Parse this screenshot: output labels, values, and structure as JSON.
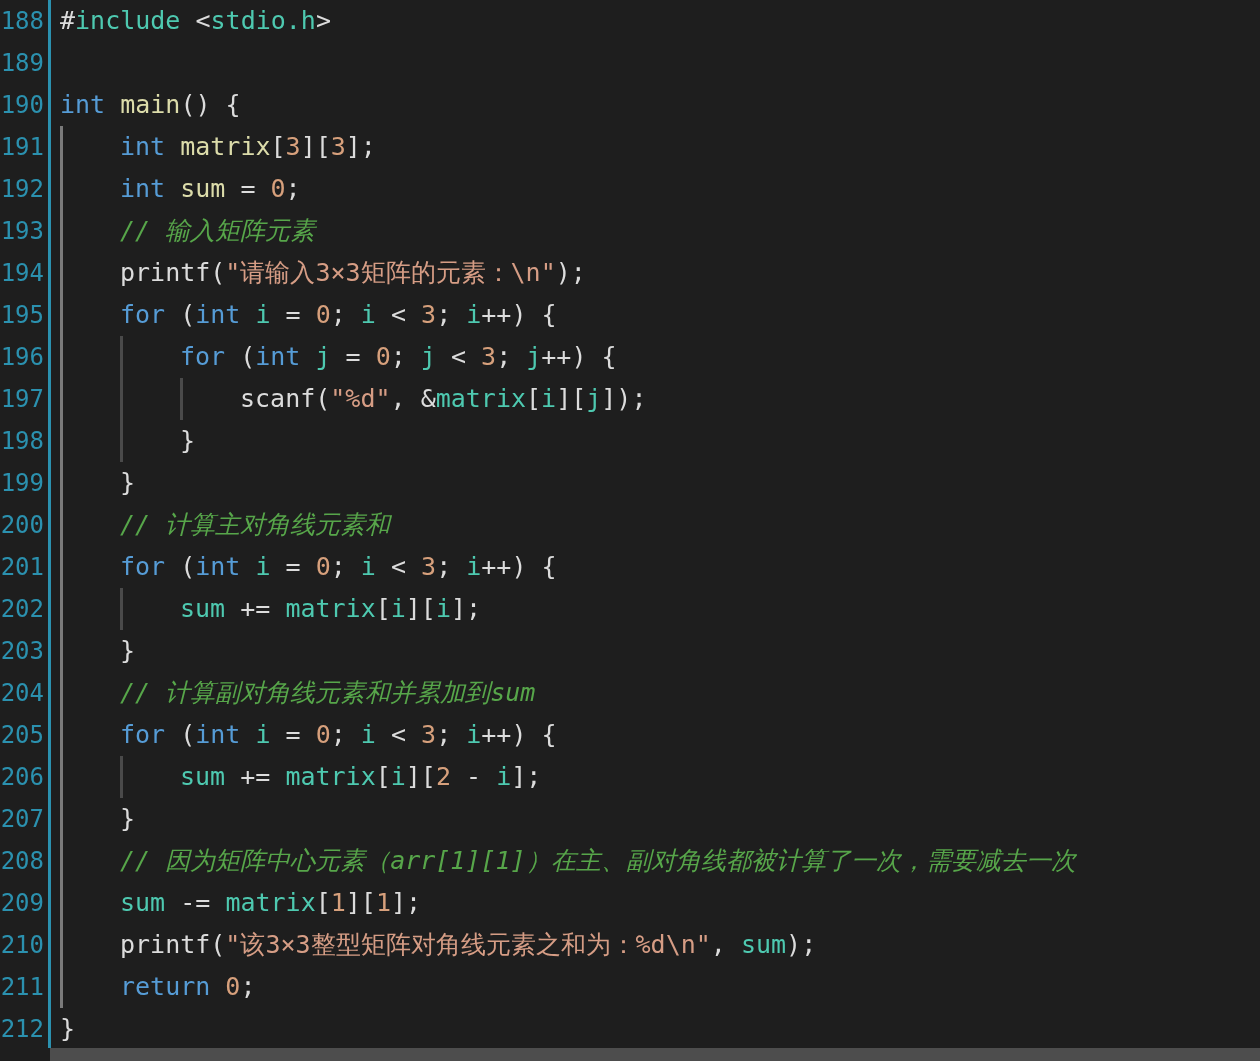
{
  "editor": {
    "lines": [
      {
        "number": "188",
        "tokens": [
          {
            "kind": "pun",
            "text": "#"
          },
          {
            "kind": "var",
            "text": "include"
          },
          {
            "kind": "pun",
            "text": " <"
          },
          {
            "kind": "var",
            "text": "stdio.h"
          },
          {
            "kind": "pun",
            "text": ">"
          }
        ]
      },
      {
        "number": "189"
      },
      {
        "number": "190",
        "tokens": [
          {
            "kind": "kw",
            "text": "int"
          },
          {
            "kind": "fn",
            "text": " main"
          },
          {
            "kind": "pun",
            "text": "() {"
          }
        ],
        "children": [
          {
            "number": "191",
            "tokens": [
              {
                "kind": "kw",
                "text": "int"
              },
              {
                "kind": "fn",
                "text": " matrix"
              },
              {
                "kind": "pun",
                "text": "["
              },
              {
                "kind": "num",
                "text": "3"
              },
              {
                "kind": "pun",
                "text": "]["
              },
              {
                "kind": "num",
                "text": "3"
              },
              {
                "kind": "pun",
                "text": "];"
              }
            ]
          },
          {
            "number": "192",
            "tokens": [
              {
                "kind": "kw",
                "text": "int"
              },
              {
                "kind": "fn",
                "text": " sum"
              },
              {
                "kind": "pun",
                "text": " = "
              },
              {
                "kind": "num",
                "text": "0"
              },
              {
                "kind": "pun",
                "text": ";"
              }
            ]
          },
          {
            "number": "193",
            "tokens": [
              {
                "kind": "com",
                "text": "// 输入矩阵元素"
              }
            ]
          },
          {
            "number": "194",
            "tokens": [
              {
                "kind": "pun",
                "text": "printf("
              },
              {
                "kind": "str",
                "text": "\"请输入3×3矩阵的元素：\\n\""
              },
              {
                "kind": "pun",
                "text": ");"
              }
            ]
          },
          {
            "number": "195",
            "tokens": [
              {
                "kind": "kw",
                "text": "for"
              },
              {
                "kind": "pun",
                "text": " ("
              },
              {
                "kind": "kw",
                "text": "int"
              },
              {
                "kind": "var",
                "text": " i"
              },
              {
                "kind": "pun",
                "text": " = "
              },
              {
                "kind": "num",
                "text": "0"
              },
              {
                "kind": "pun",
                "text": "; "
              },
              {
                "kind": "var",
                "text": "i"
              },
              {
                "kind": "pun",
                "text": " < "
              },
              {
                "kind": "num",
                "text": "3"
              },
              {
                "kind": "pun",
                "text": "; "
              },
              {
                "kind": "var",
                "text": "i"
              },
              {
                "kind": "pun",
                "text": "++) {"
              }
            ],
            "children": [
              {
                "number": "196",
                "tokens": [
                  {
                    "kind": "kw",
                    "text": "for"
                  },
                  {
                    "kind": "pun",
                    "text": " ("
                  },
                  {
                    "kind": "kw",
                    "text": "int"
                  },
                  {
                    "kind": "var",
                    "text": " j"
                  },
                  {
                    "kind": "pun",
                    "text": " = "
                  },
                  {
                    "kind": "num",
                    "text": "0"
                  },
                  {
                    "kind": "pun",
                    "text": "; "
                  },
                  {
                    "kind": "var",
                    "text": "j"
                  },
                  {
                    "kind": "pun",
                    "text": " < "
                  },
                  {
                    "kind": "num",
                    "text": "3"
                  },
                  {
                    "kind": "pun",
                    "text": "; "
                  },
                  {
                    "kind": "var",
                    "text": "j"
                  },
                  {
                    "kind": "pun",
                    "text": "++) {"
                  }
                ],
                "children": [
                  {
                    "number": "197",
                    "tokens": [
                      {
                        "kind": "pun",
                        "text": "scanf("
                      },
                      {
                        "kind": "str",
                        "text": "\"%d\""
                      },
                      {
                        "kind": "pun",
                        "text": ", &"
                      },
                      {
                        "kind": "var",
                        "text": "matrix"
                      },
                      {
                        "kind": "pun",
                        "text": "["
                      },
                      {
                        "kind": "var",
                        "text": "i"
                      },
                      {
                        "kind": "pun",
                        "text": "]["
                      },
                      {
                        "kind": "var",
                        "text": "j"
                      },
                      {
                        "kind": "pun",
                        "text": "]);"
                      }
                    ]
                  }
                ]
              },
              {
                "number": "198",
                "tokens": [
                  {
                    "kind": "pun",
                    "text": "}"
                  }
                ]
              }
            ]
          },
          {
            "number": "199",
            "tokens": [
              {
                "kind": "pun",
                "text": "}"
              }
            ]
          },
          {
            "number": "200",
            "tokens": [
              {
                "kind": "com",
                "text": "// 计算主对角线元素和"
              }
            ]
          },
          {
            "number": "201",
            "tokens": [
              {
                "kind": "kw",
                "text": "for"
              },
              {
                "kind": "pun",
                "text": " ("
              },
              {
                "kind": "kw",
                "text": "int"
              },
              {
                "kind": "var",
                "text": " i"
              },
              {
                "kind": "pun",
                "text": " = "
              },
              {
                "kind": "num",
                "text": "0"
              },
              {
                "kind": "pun",
                "text": "; "
              },
              {
                "kind": "var",
                "text": "i"
              },
              {
                "kind": "pun",
                "text": " < "
              },
              {
                "kind": "num",
                "text": "3"
              },
              {
                "kind": "pun",
                "text": "; "
              },
              {
                "kind": "var",
                "text": "i"
              },
              {
                "kind": "pun",
                "text": "++) {"
              }
            ],
            "children": [
              {
                "number": "202",
                "tokens": [
                  {
                    "kind": "var",
                    "text": "sum"
                  },
                  {
                    "kind": "pun",
                    "text": " += "
                  },
                  {
                    "kind": "var",
                    "text": "matrix"
                  },
                  {
                    "kind": "pun",
                    "text": "["
                  },
                  {
                    "kind": "var",
                    "text": "i"
                  },
                  {
                    "kind": "pun",
                    "text": "]["
                  },
                  {
                    "kind": "var",
                    "text": "i"
                  },
                  {
                    "kind": "pun",
                    "text": "];"
                  }
                ]
              }
            ]
          },
          {
            "number": "203",
            "tokens": [
              {
                "kind": "pun",
                "text": "}"
              }
            ]
          },
          {
            "number": "204",
            "tokens": [
              {
                "kind": "com",
                "text": "// 计算副对角线元素和并累加到sum"
              }
            ]
          },
          {
            "number": "205",
            "tokens": [
              {
                "kind": "kw",
                "text": "for"
              },
              {
                "kind": "pun",
                "text": " ("
              },
              {
                "kind": "kw",
                "text": "int"
              },
              {
                "kind": "var",
                "text": " i"
              },
              {
                "kind": "pun",
                "text": " = "
              },
              {
                "kind": "num",
                "text": "0"
              },
              {
                "kind": "pun",
                "text": "; "
              },
              {
                "kind": "var",
                "text": "i"
              },
              {
                "kind": "pun",
                "text": " < "
              },
              {
                "kind": "num",
                "text": "3"
              },
              {
                "kind": "pun",
                "text": "; "
              },
              {
                "kind": "var",
                "text": "i"
              },
              {
                "kind": "pun",
                "text": "++) {"
              }
            ],
            "children": [
              {
                "number": "206",
                "tokens": [
                  {
                    "kind": "var",
                    "text": "sum"
                  },
                  {
                    "kind": "pun",
                    "text": " += "
                  },
                  {
                    "kind": "var",
                    "text": "matrix"
                  },
                  {
                    "kind": "pun",
                    "text": "["
                  },
                  {
                    "kind": "var",
                    "text": "i"
                  },
                  {
                    "kind": "pun",
                    "text": "]["
                  },
                  {
                    "kind": "num",
                    "text": "2"
                  },
                  {
                    "kind": "pun",
                    "text": " - "
                  },
                  {
                    "kind": "var",
                    "text": "i"
                  },
                  {
                    "kind": "pun",
                    "text": "];"
                  }
                ]
              }
            ]
          },
          {
            "number": "207",
            "tokens": [
              {
                "kind": "pun",
                "text": "}"
              }
            ]
          },
          {
            "number": "208",
            "tokens": [
              {
                "kind": "com",
                "text": "// 因为矩阵中心元素（arr[1][1]）在主、副对角线都被计算了一次，需要减去一次"
              }
            ]
          },
          {
            "number": "209",
            "tokens": [
              {
                "kind": "var",
                "text": "sum"
              },
              {
                "kind": "pun",
                "text": " -= "
              },
              {
                "kind": "var",
                "text": "matrix"
              },
              {
                "kind": "pun",
                "text": "["
              },
              {
                "kind": "num",
                "text": "1"
              },
              {
                "kind": "pun",
                "text": "]["
              },
              {
                "kind": "num",
                "text": "1"
              },
              {
                "kind": "pun",
                "text": "];"
              }
            ]
          },
          {
            "number": "210",
            "tokens": [
              {
                "kind": "pun",
                "text": "printf("
              },
              {
                "kind": "str",
                "text": "\"该3×3整型矩阵对角线元素之和为：%d\\n\""
              },
              {
                "kind": "pun",
                "text": ", "
              },
              {
                "kind": "var",
                "text": "sum"
              },
              {
                "kind": "pun",
                "text": ");"
              }
            ]
          },
          {
            "number": "211",
            "tokens": [
              {
                "kind": "kw",
                "text": "return"
              },
              {
                "kind": "num",
                "text": " 0"
              },
              {
                "kind": "pun",
                "text": ";"
              }
            ]
          }
        ]
      },
      {
        "number": "212",
        "tokens": [
          {
            "kind": "pun",
            "text": "}"
          }
        ]
      }
    ]
  }
}
